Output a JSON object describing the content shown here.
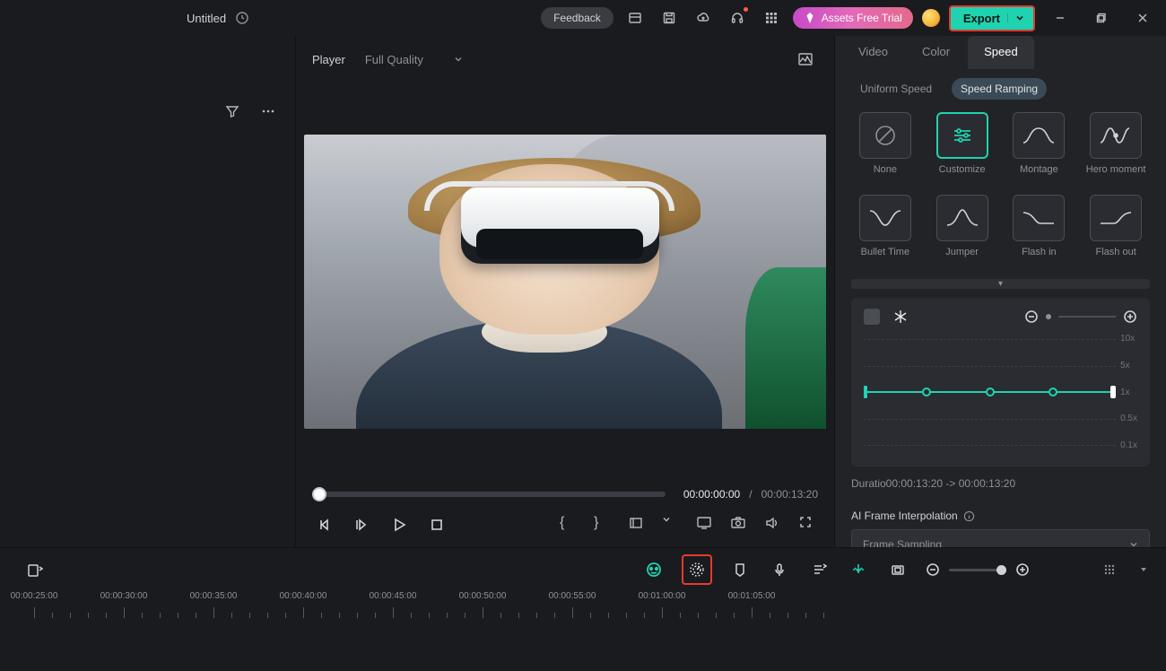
{
  "titlebar": {
    "project": "Untitled",
    "feedback": "Feedback",
    "assets": "Assets Free Trial",
    "export": "Export"
  },
  "player": {
    "label": "Player",
    "quality": "Full Quality",
    "current_time": "00:00:00:00",
    "sep": "/",
    "total_time": "00:00:13:20"
  },
  "right": {
    "tabs": {
      "video": "Video",
      "color": "Color",
      "speed": "Speed"
    },
    "subtabs": {
      "uniform": "Uniform Speed",
      "ramp": "Speed Ramping"
    },
    "presets": [
      {
        "key": "none",
        "label": "None"
      },
      {
        "key": "customize",
        "label": "Customize"
      },
      {
        "key": "montage",
        "label": "Montage"
      },
      {
        "key": "hero",
        "label": "Hero moment"
      },
      {
        "key": "bullet",
        "label": "Bullet Time"
      },
      {
        "key": "jumper",
        "label": "Jumper"
      },
      {
        "key": "flashin",
        "label": "Flash in"
      },
      {
        "key": "flashout",
        "label": "Flash out"
      }
    ],
    "ramp_y": [
      "10x",
      "5x",
      "1x",
      "0.5x",
      "0.1x"
    ],
    "duration": "Duratio00:00:13:20 -> 00:00:13:20",
    "interp_label": "AI Frame Interpolation",
    "interp_value": "Frame Sampling"
  },
  "timeline": {
    "labels": [
      "00:00:25:00",
      "00:00:30:00",
      "00:00:35:00",
      "00:00:40:00",
      "00:00:45:00",
      "00:00:50:00",
      "00:00:55:00",
      "00:01:00:00",
      "00:01:05:00"
    ]
  }
}
